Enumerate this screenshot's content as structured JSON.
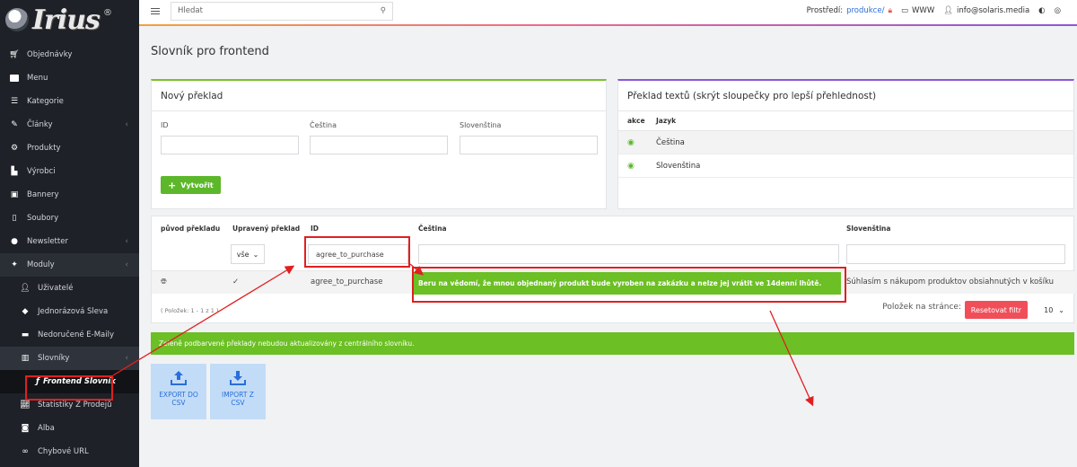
{
  "logo": {
    "text": "Irius",
    "reg": "®"
  },
  "sidebar": {
    "items": [
      {
        "label": "Objednávky",
        "icon": "cart-icon"
      },
      {
        "label": "Menu",
        "icon": "folder-icon"
      },
      {
        "label": "Kategorie",
        "icon": "list-icon"
      },
      {
        "label": "Články",
        "icon": "pencil-icon"
      },
      {
        "label": "Produkty",
        "icon": "gear-icon"
      },
      {
        "label": "Výrobci",
        "icon": "building-icon"
      },
      {
        "label": "Bannery",
        "icon": "image-icon"
      },
      {
        "label": "Soubory",
        "icon": "file-icon"
      },
      {
        "label": "Newsletter",
        "icon": "circle-icon"
      },
      {
        "label": "Moduly",
        "icon": "puzzle-icon"
      },
      {
        "label": "Uživatelé",
        "icon": "user-icon"
      },
      {
        "label": "Jednorázová Sleva",
        "icon": "tag-icon"
      },
      {
        "label": "Nedoručené E-Maily",
        "icon": "truck-icon"
      },
      {
        "label": "Slovníky",
        "icon": "books-icon"
      },
      {
        "label": "Frontend Slovník",
        "icon": "font-icon"
      },
      {
        "label": "Statistiky Z Prodejů",
        "icon": "chart-icon"
      },
      {
        "label": "Alba",
        "icon": "camera-icon"
      },
      {
        "label": "Chybové URL",
        "icon": "link-icon"
      }
    ]
  },
  "topbar": {
    "search_placeholder": "Hledat",
    "env_label": "Prostředí:",
    "env_value": "produkce/",
    "www": "WWW",
    "user": "info@solaris.media"
  },
  "page": {
    "title": "Slovník pro frontend"
  },
  "new_translation": {
    "title": "Nový překlad",
    "fields": [
      "ID",
      "Čeština",
      "Slovenština"
    ],
    "create_label": "Vytvořit"
  },
  "lang_panel": {
    "title": "Překlad textů (skrýt sloupečky pro lepší přehlednost)",
    "col_action": "akce",
    "col_lang": "Jazyk",
    "languages": [
      "Čeština",
      "Slovenština"
    ]
  },
  "list": {
    "headers": [
      "původ překladu",
      "Upravený překlad",
      "ID",
      "Čeština",
      "Slovenština"
    ],
    "filter_select": "vše",
    "filter_id": "agree_to_purchase",
    "row": {
      "id": "agree_to_purchase",
      "cs": "Beru na vědomí, že mnou objednaný produkt bude vyroben na zakázku a nelze jej vrátit ve 14denní lhůtě.",
      "sk": "Súhlasím s nákupom produktov obsiahnutých v košíku"
    },
    "pager_info": "( Položek: 1 - 1 z 1 )",
    "per_page_label": "Položek na stránce:",
    "reset_label": "Resetovat filtr",
    "per_page_value": "10"
  },
  "alert": "Zeleně podbarvené překlady nebudou aktualizovány z centrálního slovníku.",
  "tiles": [
    {
      "label": "EXPORT DO CSV"
    },
    {
      "label": "IMPORT Z CSV"
    }
  ],
  "colors": {
    "accent_green": "#6cbf24",
    "sidebar_bg": "#1e2127",
    "reset_red": "#f04f5a",
    "annotation_red": "#e02020"
  }
}
